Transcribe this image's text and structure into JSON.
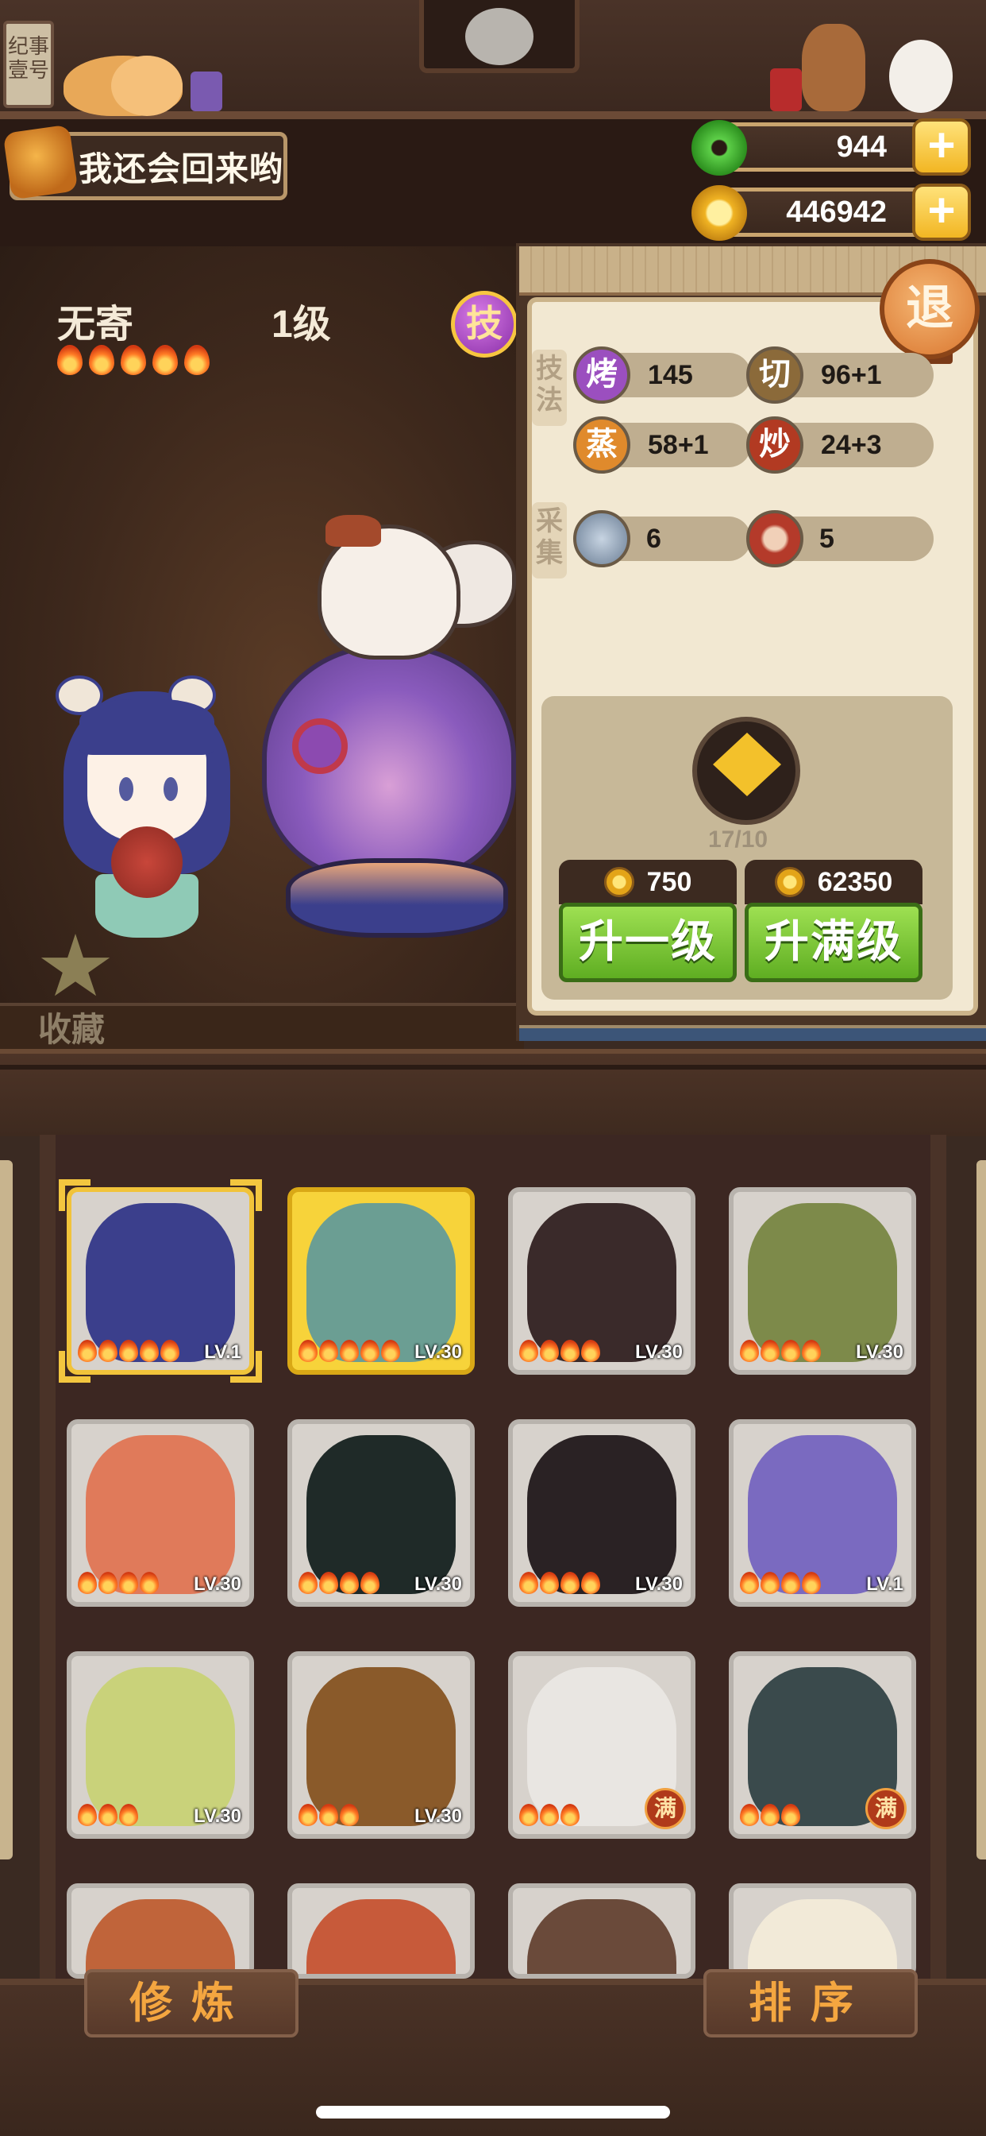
{
  "shelf": {
    "sign_text": "纪事 壹号"
  },
  "player": {
    "name": "我还会回来哟"
  },
  "resources": {
    "jade": {
      "value": "944",
      "icon": "jade-icon",
      "color": "#3fae2c"
    },
    "coins": {
      "value": "446942",
      "icon": "coin-icon",
      "color": "#f0b323"
    },
    "plus_label": "+"
  },
  "character": {
    "name": "无寄",
    "level": "1级",
    "stars": 5,
    "skill_button": "技",
    "favorite_label": "收藏"
  },
  "panel": {
    "exit_label": "退",
    "technique_label": "技法",
    "gather_label": "采集",
    "techniques": [
      {
        "icon_text": "烤",
        "value": "145",
        "color": "#9b4fbf"
      },
      {
        "icon_text": "切",
        "value": "96+1",
        "color": "#8b6a3a"
      },
      {
        "icon_text": "蒸",
        "value": "58+1",
        "color": "#e08a2c"
      },
      {
        "icon_text": "炒",
        "value": "24+3",
        "color": "#b23a22"
      }
    ],
    "gathering": [
      {
        "icon": "fish-icon",
        "value": "6"
      },
      {
        "icon": "meat-icon",
        "value": "5"
      }
    ],
    "token_count": "17/10",
    "upgrade_one": {
      "cost": "750",
      "label": "升一级"
    },
    "upgrade_max": {
      "cost": "62350",
      "label": "升满级"
    }
  },
  "roster": [
    {
      "lv": "LV.1",
      "stars": 5,
      "style": "selected",
      "color": "#3b3f8c"
    },
    {
      "lv": "LV.30",
      "stars": 5,
      "style": "gold",
      "color": "#6b9e93"
    },
    {
      "lv": "LV.30",
      "stars": 4,
      "style": "normal",
      "color": "#3a2a2a"
    },
    {
      "lv": "LV.30",
      "stars": 4,
      "style": "normal",
      "color": "#7d8a4a"
    },
    {
      "lv": "LV.30",
      "stars": 4,
      "style": "normal",
      "color": "#e07a5a"
    },
    {
      "lv": "LV.30",
      "stars": 4,
      "style": "normal",
      "color": "#1f2a28"
    },
    {
      "lv": "LV.30",
      "stars": 4,
      "style": "normal",
      "color": "#2a2224"
    },
    {
      "lv": "LV.1",
      "stars": 4,
      "style": "normal",
      "color": "#7a6ac0"
    },
    {
      "lv": "LV.30",
      "stars": 3,
      "style": "normal",
      "color": "#c9d27a"
    },
    {
      "lv": "LV.30",
      "stars": 3,
      "style": "normal",
      "color": "#8a5a2a"
    },
    {
      "lv": "满",
      "stars": 3,
      "style": "max",
      "color": "#e9e6e2"
    },
    {
      "lv": "满",
      "stars": 3,
      "style": "max",
      "color": "#3a4a4c"
    },
    {
      "lv": "",
      "stars": 0,
      "style": "partial",
      "color": "#c0643a"
    },
    {
      "lv": "",
      "stars": 0,
      "style": "partial",
      "color": "#c75a3a"
    },
    {
      "lv": "",
      "stars": 0,
      "style": "partial",
      "color": "#6a4a3a"
    },
    {
      "lv": "",
      "stars": 0,
      "style": "partial",
      "color": "#f2ead8"
    }
  ],
  "bottom": {
    "train_label": "修炼",
    "sort_label": "排序"
  }
}
